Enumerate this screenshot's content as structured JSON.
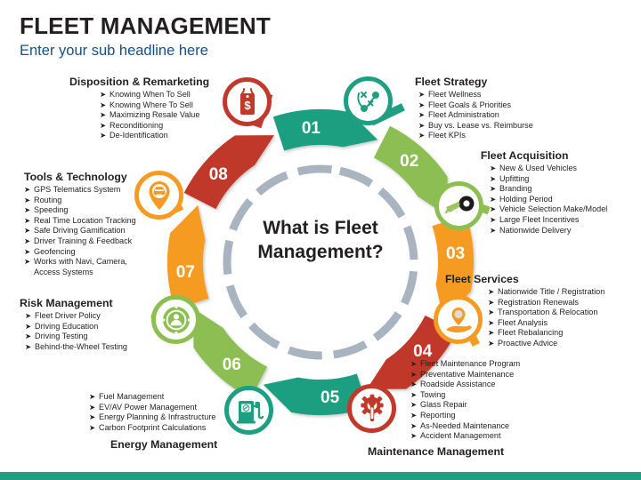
{
  "header": {
    "title": "FLEET MANAGEMENT",
    "subtitle": "Enter your sub headline here"
  },
  "center": {
    "line1": "What is Fleet",
    "line2": "Management?"
  },
  "colors": {
    "teal": "#1f9e81",
    "green": "#8cbe52",
    "orange": "#f59b23",
    "red": "#c0392b",
    "dark_red": "#bf3a30",
    "ring_gray": "#a8b4c0",
    "title": "#231f20",
    "subtitle": "#1a4f82",
    "footer_bar": "#1f9e81"
  },
  "segments": [
    {
      "number": "01",
      "heading": "Fleet Strategy",
      "color": "#1f9e81",
      "icon": "strategy-play-icon",
      "items": [
        "Fleet Wellness",
        "Fleet Goals & Priorities",
        "Fleet Administration",
        "Buy vs. Lease vs. Reimburse",
        "Fleet KPIs"
      ]
    },
    {
      "number": "02",
      "heading": "Fleet Acquisition",
      "color": "#8cbe52",
      "icon": "car-key-icon",
      "items": [
        "New & Used Vehicles",
        "Upfitting",
        "Branding",
        "Holding Period",
        "Vehicle Selection Make/Model",
        "Large Fleet Incentives",
        "Nationwide Delivery"
      ]
    },
    {
      "number": "03",
      "heading": "Fleet Services",
      "color": "#f59b23",
      "icon": "hand-pin-icon",
      "items": [
        "Nationwide Title / Registration",
        "Registration Renewals",
        "Transportation & Relocation",
        "Fleet Analysis",
        "Fleet Rebalancing",
        "Proactive Advice"
      ]
    },
    {
      "number": "04",
      "heading": "Maintenance Management",
      "color": "#c0392b",
      "icon": "gear-wrench-icon",
      "items": [
        "Fleet Maintenance Program",
        "Preventative Maintenance",
        "Roadside Assistance",
        "Towing",
        "Glass Repair",
        "Reporting",
        "As-Needed Maintenance",
        "Accident Management"
      ]
    },
    {
      "number": "05",
      "heading": "Energy Management",
      "color": "#1f9e81",
      "icon": "fuel-pump-icon",
      "items": [
        "Fuel Management",
        "EV/AV Power Management",
        "Energy Planning & Infrastructure",
        "Carbon Footprint Calculations"
      ]
    },
    {
      "number": "06",
      "heading": "Risk Management",
      "color": "#8cbe52",
      "icon": "gear-person-icon",
      "items": [
        "Fleet Driver Policy",
        "Driving Education",
        "Driving Testing",
        "Behind-the-Wheel Testing"
      ]
    },
    {
      "number": "07",
      "heading": "Tools & Technology",
      "color": "#f59b23",
      "icon": "car-map-pin-icon",
      "items": [
        "GPS Telematics System",
        "Routing",
        "Speeding",
        "Real Time Location Tracking",
        "Safe Driving Gamification",
        "Driver Training & Feedback",
        "Geofencing",
        "Works with Navi, Camera,",
        "Access Systems"
      ]
    },
    {
      "number": "08",
      "heading": "Disposition & Remarketing",
      "color": "#c0392b",
      "icon": "price-tag-icon",
      "items": [
        "Knowing When To Sell",
        "Knowing Where To Sell",
        "Maximizing Resale Value",
        "Reconditioning",
        "De-Identification"
      ]
    }
  ],
  "bullet_glyph": "➤"
}
